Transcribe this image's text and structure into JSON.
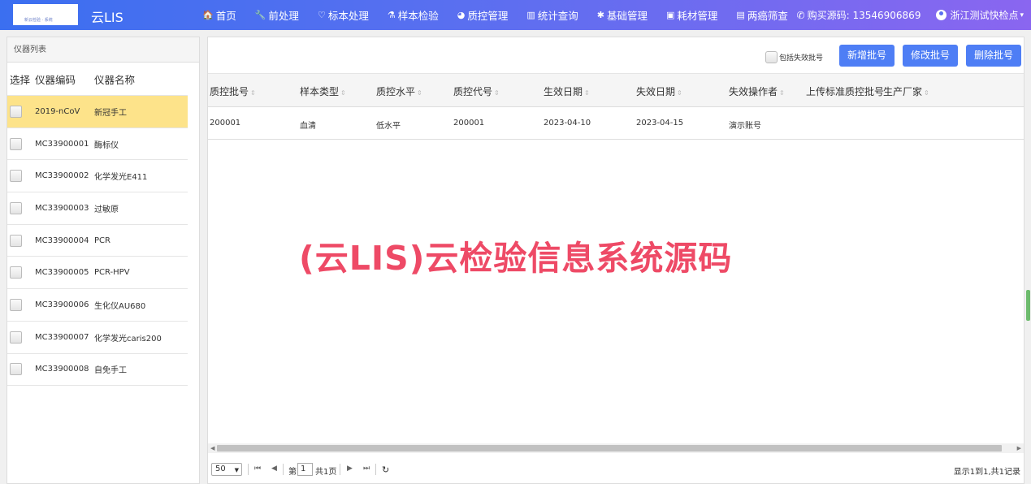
{
  "nav": {
    "logo_text": "新云检验 · 系统",
    "brand": "云LIS",
    "items": [
      {
        "icon": "🏠",
        "label": "首页"
      },
      {
        "icon": "🔧",
        "label": "前处理"
      },
      {
        "icon": "♡",
        "label": "标本处理"
      },
      {
        "icon": "⚗",
        "label": "样本检验"
      },
      {
        "icon": "◕",
        "label": "质控管理"
      },
      {
        "icon": "▥",
        "label": "统计查询"
      },
      {
        "icon": "✱",
        "label": "基础管理"
      },
      {
        "icon": "▣",
        "label": "耗材管理"
      },
      {
        "icon": "▤",
        "label": "两癌筛查"
      }
    ],
    "phone_label": "购买源码: 13546906869",
    "user_label": "浙江测试快检点"
  },
  "left": {
    "title": "仪器列表",
    "headers": [
      "选择",
      "仪器编码",
      "仪器名称"
    ],
    "rows": [
      {
        "code": "2019-nCoV",
        "name": "新冠手工",
        "selected": true
      },
      {
        "code": "MC33900001",
        "name": "酶标仪",
        "selected": false
      },
      {
        "code": "MC33900002",
        "name": "化学发光E411",
        "selected": false
      },
      {
        "code": "MC33900003",
        "name": "过敏原",
        "selected": false
      },
      {
        "code": "MC33900004",
        "name": "PCR",
        "selected": false
      },
      {
        "code": "MC33900005",
        "name": "PCR-HPV",
        "selected": false
      },
      {
        "code": "MC33900006",
        "name": "生化仪AU680",
        "selected": false
      },
      {
        "code": "MC33900007",
        "name": "化学发光caris200",
        "selected": false
      },
      {
        "code": "MC33900008",
        "name": "自免手工",
        "selected": false
      }
    ]
  },
  "toolbar": {
    "include_expired_label": "包括失效批号",
    "add_label": "新增批号",
    "edit_label": "修改批号",
    "delete_label": "删除批号"
  },
  "grid": {
    "headers": [
      "质控批号",
      "样本类型",
      "质控水平",
      "质控代号",
      "生效日期",
      "失效日期",
      "失效操作者",
      "上传标准质控批号",
      "生产厂家"
    ],
    "row": {
      "batch": "200001",
      "sample_type": "血清",
      "level": "低水平",
      "code": "200001",
      "start_date": "2023-04-10",
      "end_date": "2023-04-15",
      "operator": "演示账号"
    }
  },
  "watermark": "(云LIS)云检验信息系统源码",
  "pager": {
    "page_size": "50",
    "page_prefix": "第",
    "page_value": "1",
    "page_total": "共1页",
    "info": "显示1到1,共1记录"
  }
}
